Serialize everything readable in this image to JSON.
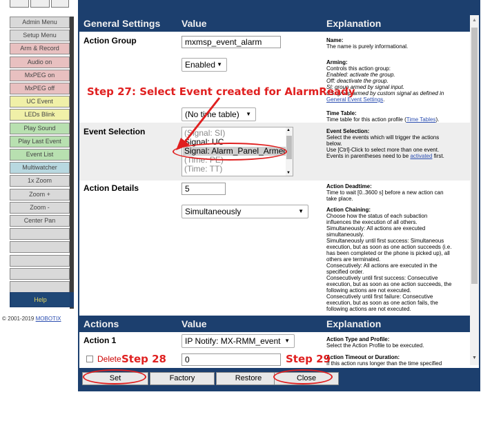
{
  "menu": {
    "items": [
      {
        "label": "Admin Menu",
        "bg": "#d9d9d9"
      },
      {
        "label": "Setup Menu",
        "bg": "#d9d9d9"
      },
      {
        "label": "Arm & Record",
        "bg": "#e8c0c0"
      },
      {
        "label": "Audio on",
        "bg": "#e8c0c0"
      },
      {
        "label": "MxPEG on",
        "bg": "#e8c0c0"
      },
      {
        "label": "MxPEG off",
        "bg": "#e8c0c0"
      },
      {
        "label": "UC Event",
        "bg": "#f0f0a8"
      },
      {
        "label": "LEDs Blink",
        "bg": "#f0f0a8"
      },
      {
        "label": "Play Sound",
        "bg": "#b8e0b0"
      },
      {
        "label": "Play Last Event",
        "bg": "#b8e0b0"
      },
      {
        "label": "Event List",
        "bg": "#b8e0b0"
      },
      {
        "label": "Multiwatcher",
        "bg": "#b8d8e0"
      },
      {
        "label": "1x Zoom",
        "bg": "#d9d9d9"
      },
      {
        "label": "Zoom +",
        "bg": "#d9d9d9"
      },
      {
        "label": "Zoom -",
        "bg": "#d9d9d9"
      },
      {
        "label": "Center Pan",
        "bg": "#d9d9d9"
      },
      {
        "label": "",
        "bg": "#d9d9d9"
      },
      {
        "label": "",
        "bg": "#d9d9d9"
      },
      {
        "label": "",
        "bg": "#d9d9d9"
      },
      {
        "label": "",
        "bg": "#d9d9d9"
      },
      {
        "label": "",
        "bg": "#d9d9d9"
      }
    ],
    "help": "Help",
    "copyright_prefix": "© 2001-2019 ",
    "copyright_link": "MOBOTIX"
  },
  "general_header": {
    "col1": "General Settings",
    "col2": "Value",
    "col3": "Explanation"
  },
  "action_group": {
    "label": "Action Group",
    "name_value": "mxmsp_event_alarm",
    "name_expl_title": "Name:",
    "name_expl": "The name is purely informational."
  },
  "arming": {
    "value": "Enabled",
    "expl_title": "Arming:",
    "expl_lines": [
      "Controls this action group:",
      "Enabled: activate the group.",
      "Off: deactivate the group.",
      "SI: group armed by signal input.",
      "CS: group armed by custom signal as defined in"
    ],
    "expl_link": "General Event Settings",
    "expl_link_suffix": "."
  },
  "time_table": {
    "value": "(No time table)",
    "expl_title": "Time Table:",
    "expl_prefix": "Time table for this action profile (",
    "expl_link": "Time Tables",
    "expl_suffix": ")."
  },
  "event_selection": {
    "label": "Event Selection",
    "options": [
      "(Signal: SI)",
      "Signal: UC",
      "Signal: Alarm_Panel_Armed",
      "(Time: PE)",
      "(Time: TT)"
    ],
    "selected_index": 2,
    "expl_title": "Event Selection:",
    "expl_lines": [
      "Select the events which will trigger the actions",
      "below.",
      "Use [Ctrl]-Click to select more than one event.",
      "Events in parentheses need to be"
    ],
    "expl_link": "activated",
    "expl_link_suffix": " first."
  },
  "action_details": {
    "label": "Action Details",
    "deadtime_value": "5",
    "deadtime_title": "Action Deadtime:",
    "deadtime_lines": [
      "Time to wait [0..3600 s] before a new action can",
      "take place."
    ],
    "chaining_value": "Simultaneously",
    "chaining_title": "Action Chaining:",
    "chaining_lines": [
      "Choose how the status of each subaction",
      "influences the execution of all others.",
      "Simultaneously: All actions are executed",
      "simultaneously.",
      "Simultaneously until first success: Simultaneous",
      "execution, but as soon as one action succeeds (i.e.",
      "has been completed or the phone is picked up), all",
      "others are terminated.",
      "Consecutively: All actions are executed in the",
      "specified order.",
      "Consecutively until first success: Consecutive",
      "execution, but as soon as one action succeeds, the",
      "following actions are not executed.",
      "Consecutively until first failure: Consecutive",
      "execution, but as soon as one action fails, the",
      "following actions are not executed."
    ]
  },
  "actions_header": {
    "col1": "Actions",
    "col2": "Value",
    "col3": "Explanation"
  },
  "action1": {
    "label": "Action 1",
    "value": "IP Notify: MX-RMM_event",
    "expl_title": "Action Type and Profile:",
    "expl": "Select the Action Profile to be executed.",
    "delete_label": "Delete",
    "timeout_value": "0",
    "timeout_title": "Action Timeout or Duration:",
    "timeout_lines": [
      "If this action runs longer than the time specified"
    ]
  },
  "buttons": {
    "set": "Set",
    "factory": "Factory",
    "restore": "Restore",
    "close": "Close"
  },
  "annotations": {
    "step27": "Step 27: Select Event created for AlarmReady",
    "step28": "Step 28",
    "step29": "Step 29",
    "color": "#e02020"
  }
}
